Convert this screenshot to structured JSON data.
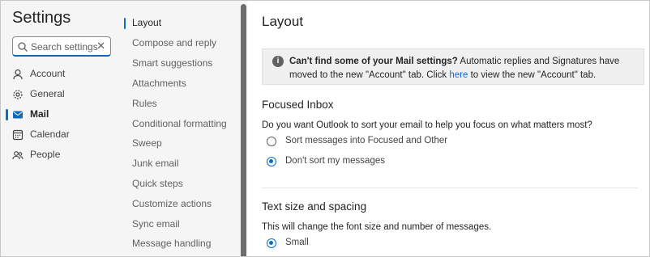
{
  "sidebar": {
    "title": "Settings",
    "search": {
      "placeholder": "Search settings",
      "clear": "✕"
    },
    "items": [
      {
        "label": "Account",
        "icon": "person-icon"
      },
      {
        "label": "General",
        "icon": "gear-icon"
      },
      {
        "label": "Mail",
        "icon": "mail-icon",
        "active": true
      },
      {
        "label": "Calendar",
        "icon": "calendar-icon"
      },
      {
        "label": "People",
        "icon": "people-icon"
      }
    ]
  },
  "submenu": {
    "items": [
      {
        "label": "Layout",
        "active": true
      },
      {
        "label": "Compose and reply"
      },
      {
        "label": "Smart suggestions"
      },
      {
        "label": "Attachments"
      },
      {
        "label": "Rules"
      },
      {
        "label": "Conditional formatting"
      },
      {
        "label": "Sweep"
      },
      {
        "label": "Junk email"
      },
      {
        "label": "Quick steps"
      },
      {
        "label": "Customize actions"
      },
      {
        "label": "Sync email"
      },
      {
        "label": "Message handling"
      }
    ]
  },
  "main": {
    "title": "Layout",
    "notice": {
      "bold": "Can't find some of your Mail settings?",
      "text_before": " Automatic replies and Signatures have moved to the new \"Account\" tab. Click ",
      "link": "here",
      "text_after": " to view the new \"Account\" tab."
    },
    "focused_inbox": {
      "heading": "Focused Inbox",
      "question": "Do you want Outlook to sort your email to help you focus on what matters most?",
      "options": [
        {
          "label": "Sort messages into Focused and Other",
          "checked": false
        },
        {
          "label": "Don't sort my messages",
          "checked": true
        }
      ]
    },
    "text_size": {
      "heading": "Text size and spacing",
      "description": "This will change the font size and number of messages.",
      "options": [
        {
          "label": "Small",
          "checked": true
        }
      ]
    }
  },
  "colors": {
    "accent": "#0f6cbd",
    "panel_bg": "#f5f5f5"
  }
}
